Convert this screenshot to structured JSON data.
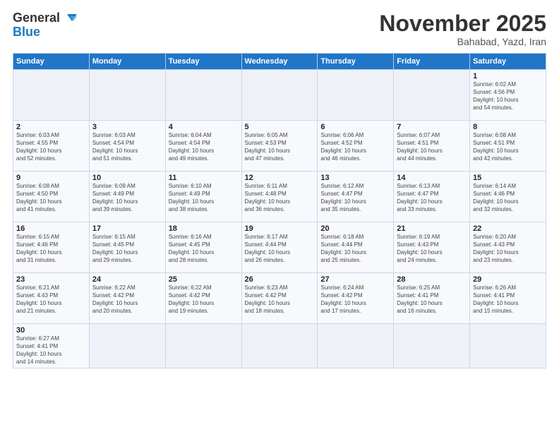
{
  "logo": {
    "general": "General",
    "blue": "Blue"
  },
  "header": {
    "month": "November 2025",
    "location": "Bahabad, Yazd, Iran"
  },
  "weekdays": [
    "Sunday",
    "Monday",
    "Tuesday",
    "Wednesday",
    "Thursday",
    "Friday",
    "Saturday"
  ],
  "weeks": [
    [
      {
        "day": "",
        "info": ""
      },
      {
        "day": "",
        "info": ""
      },
      {
        "day": "",
        "info": ""
      },
      {
        "day": "",
        "info": ""
      },
      {
        "day": "",
        "info": ""
      },
      {
        "day": "",
        "info": ""
      },
      {
        "day": "1",
        "info": "Sunrise: 6:02 AM\nSunset: 4:56 PM\nDaylight: 10 hours\nand 54 minutes."
      }
    ],
    [
      {
        "day": "2",
        "info": "Sunrise: 6:03 AM\nSunset: 4:55 PM\nDaylight: 10 hours\nand 52 minutes."
      },
      {
        "day": "3",
        "info": "Sunrise: 6:03 AM\nSunset: 4:54 PM\nDaylight: 10 hours\nand 51 minutes."
      },
      {
        "day": "4",
        "info": "Sunrise: 6:04 AM\nSunset: 4:54 PM\nDaylight: 10 hours\nand 49 minutes."
      },
      {
        "day": "5",
        "info": "Sunrise: 6:05 AM\nSunset: 4:53 PM\nDaylight: 10 hours\nand 47 minutes."
      },
      {
        "day": "6",
        "info": "Sunrise: 6:06 AM\nSunset: 4:52 PM\nDaylight: 10 hours\nand 46 minutes."
      },
      {
        "day": "7",
        "info": "Sunrise: 6:07 AM\nSunset: 4:51 PM\nDaylight: 10 hours\nand 44 minutes."
      },
      {
        "day": "8",
        "info": "Sunrise: 6:08 AM\nSunset: 4:51 PM\nDaylight: 10 hours\nand 42 minutes."
      }
    ],
    [
      {
        "day": "9",
        "info": "Sunrise: 6:08 AM\nSunset: 4:50 PM\nDaylight: 10 hours\nand 41 minutes."
      },
      {
        "day": "10",
        "info": "Sunrise: 6:09 AM\nSunset: 4:49 PM\nDaylight: 10 hours\nand 39 minutes."
      },
      {
        "day": "11",
        "info": "Sunrise: 6:10 AM\nSunset: 4:49 PM\nDaylight: 10 hours\nand 38 minutes."
      },
      {
        "day": "12",
        "info": "Sunrise: 6:11 AM\nSunset: 4:48 PM\nDaylight: 10 hours\nand 36 minutes."
      },
      {
        "day": "13",
        "info": "Sunrise: 6:12 AM\nSunset: 4:47 PM\nDaylight: 10 hours\nand 35 minutes."
      },
      {
        "day": "14",
        "info": "Sunrise: 6:13 AM\nSunset: 4:47 PM\nDaylight: 10 hours\nand 33 minutes."
      },
      {
        "day": "15",
        "info": "Sunrise: 6:14 AM\nSunset: 4:46 PM\nDaylight: 10 hours\nand 32 minutes."
      }
    ],
    [
      {
        "day": "16",
        "info": "Sunrise: 6:15 AM\nSunset: 4:46 PM\nDaylight: 10 hours\nand 31 minutes."
      },
      {
        "day": "17",
        "info": "Sunrise: 6:15 AM\nSunset: 4:45 PM\nDaylight: 10 hours\nand 29 minutes."
      },
      {
        "day": "18",
        "info": "Sunrise: 6:16 AM\nSunset: 4:45 PM\nDaylight: 10 hours\nand 28 minutes."
      },
      {
        "day": "19",
        "info": "Sunrise: 6:17 AM\nSunset: 4:44 PM\nDaylight: 10 hours\nand 26 minutes."
      },
      {
        "day": "20",
        "info": "Sunrise: 6:18 AM\nSunset: 4:44 PM\nDaylight: 10 hours\nand 25 minutes."
      },
      {
        "day": "21",
        "info": "Sunrise: 6:19 AM\nSunset: 4:43 PM\nDaylight: 10 hours\nand 24 minutes."
      },
      {
        "day": "22",
        "info": "Sunrise: 6:20 AM\nSunset: 4:43 PM\nDaylight: 10 hours\nand 23 minutes."
      }
    ],
    [
      {
        "day": "23",
        "info": "Sunrise: 6:21 AM\nSunset: 4:43 PM\nDaylight: 10 hours\nand 21 minutes."
      },
      {
        "day": "24",
        "info": "Sunrise: 6:22 AM\nSunset: 4:42 PM\nDaylight: 10 hours\nand 20 minutes."
      },
      {
        "day": "25",
        "info": "Sunrise: 6:22 AM\nSunset: 4:42 PM\nDaylight: 10 hours\nand 19 minutes."
      },
      {
        "day": "26",
        "info": "Sunrise: 6:23 AM\nSunset: 4:42 PM\nDaylight: 10 hours\nand 18 minutes."
      },
      {
        "day": "27",
        "info": "Sunrise: 6:24 AM\nSunset: 4:42 PM\nDaylight: 10 hours\nand 17 minutes."
      },
      {
        "day": "28",
        "info": "Sunrise: 6:25 AM\nSunset: 4:41 PM\nDaylight: 10 hours\nand 16 minutes."
      },
      {
        "day": "29",
        "info": "Sunrise: 6:26 AM\nSunset: 4:41 PM\nDaylight: 10 hours\nand 15 minutes."
      }
    ],
    [
      {
        "day": "30",
        "info": "Sunrise: 6:27 AM\nSunset: 4:41 PM\nDaylight: 10 hours\nand 14 minutes."
      },
      {
        "day": "",
        "info": ""
      },
      {
        "day": "",
        "info": ""
      },
      {
        "day": "",
        "info": ""
      },
      {
        "day": "",
        "info": ""
      },
      {
        "day": "",
        "info": ""
      },
      {
        "day": "",
        "info": ""
      }
    ]
  ]
}
